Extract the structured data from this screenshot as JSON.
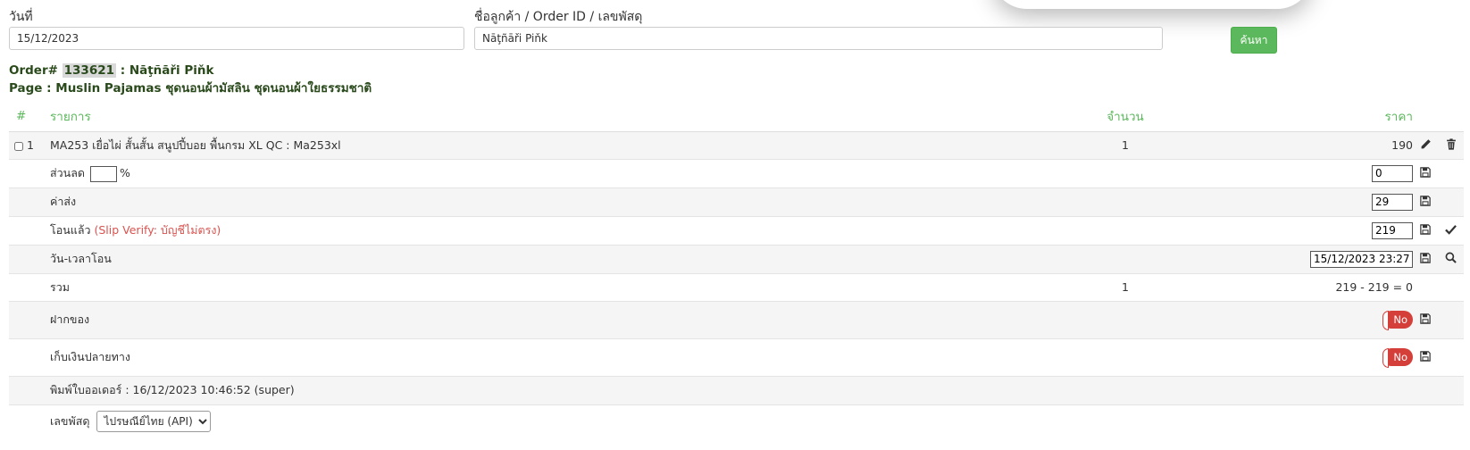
{
  "search": {
    "date_label": "วันที่",
    "date_value": "15/12/2023",
    "customer_label": "ชื่อลูกค้า / Order ID / เลขพัสดุ",
    "customer_value": "Nāţñāři Piňk",
    "search_button": "ค้นหา"
  },
  "order": {
    "order_prefix": "Order#",
    "order_id": "133621",
    "customer_suffix": ": Nāţñāři Piňk",
    "page_line": "Page : Muslin Pajamas ชุดนอนผ้ามัสลิน ชุดนอนผ้าใยธรรมชาติ"
  },
  "table": {
    "headers": {
      "num": "#",
      "item": "รายการ",
      "qty": "จำนวน",
      "price": "ราคา"
    },
    "item_row": {
      "index": "1",
      "name": "MA253 เยื่อไผ่ สั้นสั้น สนูปปี้บอย พื้นกรม XL QC : Ma253xl",
      "qty": "1",
      "price": "190"
    },
    "discount": {
      "label": "ส่วนลด",
      "percent_sign": "%",
      "value": "0"
    },
    "shipping": {
      "label": "ค่าส่ง",
      "value": "29"
    },
    "transferred": {
      "label": "โอนแล้ว",
      "note": "(Slip Verify: บัญชีไม่ตรง)",
      "value": "219"
    },
    "transfer_time": {
      "label": "วัน-เวลาโอน",
      "value": "15/12/2023 23:27"
    },
    "total": {
      "label": "รวม",
      "qty": "1",
      "value": "219 - 219 = 0"
    },
    "deposit": {
      "label": "ฝากของ",
      "toggle": "No"
    },
    "cod": {
      "label": "เก็บเงินปลายทาง",
      "toggle": "No"
    },
    "printed": {
      "text": "พิมพ์ใบออเดอร์ : 16/12/2023 10:46:52 (super)"
    },
    "tracking": {
      "label": "เลขพัสดุ",
      "selected": "ไปรษณีย์ไทย (API)"
    }
  },
  "colors": {
    "green_accent": "#5cb85c",
    "order_text": "#2a4a1c",
    "toggle_red": "#d43f3a",
    "slip_red": "#d9534f"
  }
}
